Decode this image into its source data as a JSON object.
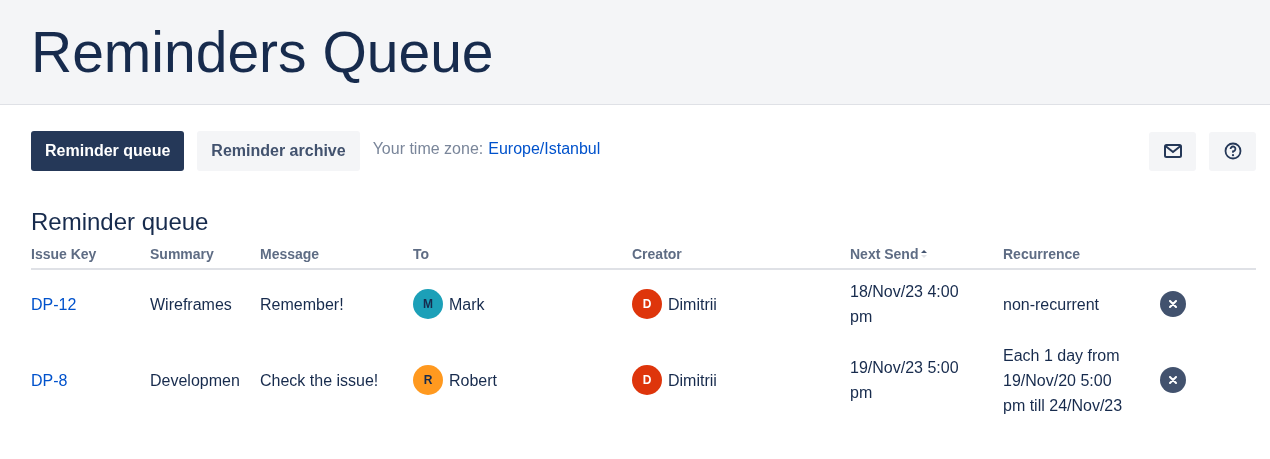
{
  "header": {
    "title": "Reminders Queue"
  },
  "tabs": [
    {
      "label": "Reminder queue",
      "selected": true
    },
    {
      "label": "Reminder archive",
      "selected": false
    }
  ],
  "time_zone": {
    "label": "Your time zone:",
    "value": "Europe/Istanbul"
  },
  "section_title": "Reminder queue",
  "table": {
    "columns": [
      {
        "label": "Issue Key",
        "sorted": false
      },
      {
        "label": "Summary",
        "sorted": false
      },
      {
        "label": "Message",
        "sorted": false
      },
      {
        "label": "To",
        "sorted": false
      },
      {
        "label": "Creator",
        "sorted": false
      },
      {
        "label": "Next Send",
        "sorted": true
      },
      {
        "label": "Recurrence",
        "sorted": false
      }
    ],
    "rows": [
      {
        "issue_key": "DP-12",
        "summary": "Wireframes",
        "message": "Remember!",
        "to": {
          "initial": "M",
          "name": "Mark",
          "color": "#1ca0b8"
        },
        "creator": {
          "initial": "D",
          "name": "Dimitrii",
          "color": "#de350b"
        },
        "next_send": "18/Nov/23 4:00 pm",
        "recurrence": "non-recurrent"
      },
      {
        "issue_key": "DP-8",
        "summary": "Developmen",
        "message": "Check the issue!",
        "to": {
          "initial": "R",
          "name": "Robert",
          "color": "#ff991f"
        },
        "creator": {
          "initial": "D",
          "name": "Dimitrii",
          "color": "#de350b"
        },
        "next_send": "19/Nov/23 5:00 pm",
        "recurrence": "Each 1 day from 19/Nov/20 5:00 pm till 24/Nov/23"
      }
    ]
  }
}
